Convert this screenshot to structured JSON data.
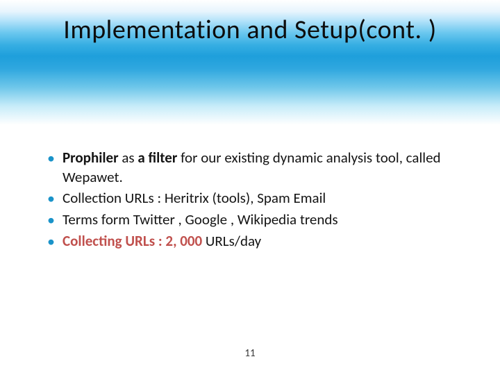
{
  "slide": {
    "title": "Implementation and Setup(cont. )",
    "bullets": [
      {
        "parts": [
          {
            "text": "Prophiler",
            "style": "bold"
          },
          {
            "text": " as ",
            "style": "plain"
          },
          {
            "text": "a filter",
            "style": "bold"
          },
          {
            "text": " for our existing dynamic analysis tool, called Wepawet.",
            "style": "plain"
          }
        ]
      },
      {
        "parts": [
          {
            "text": "Collection URLs : Heritrix (tools), Spam Email",
            "style": "plain"
          }
        ]
      },
      {
        "parts": [
          {
            "text": "Terms form Twitter , Google , Wikipedia trends",
            "style": "plain"
          }
        ]
      },
      {
        "parts": [
          {
            "text": "Collecting URLs : 2, 000",
            "style": "accent"
          },
          {
            "text": " URLs/day",
            "style": "plain"
          }
        ]
      }
    ],
    "page_number": "11"
  }
}
